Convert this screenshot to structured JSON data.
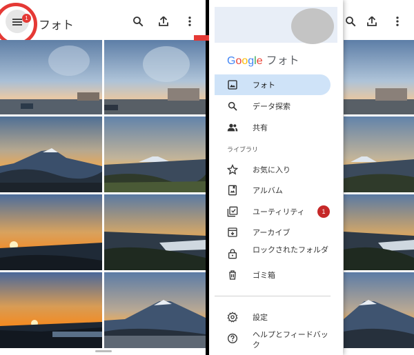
{
  "left": {
    "app_title": "フォト",
    "menu_badge": "1",
    "icons": [
      "menu-icon",
      "search-icon",
      "upload-icon",
      "more-vert-icon"
    ]
  },
  "right": {
    "brand_google": [
      "G",
      "o",
      "o",
      "g",
      "l",
      "e"
    ],
    "brand_colors": [
      "#4285F4",
      "#EA4335",
      "#FBBC05",
      "#4285F4",
      "#34A853",
      "#EA4335"
    ],
    "brand_sub": "フォト",
    "section_label": "ライブラリ",
    "nav": [
      {
        "label": "フォト",
        "icon": "photo-icon",
        "active": true
      },
      {
        "label": "データ探索",
        "icon": "search-icon"
      },
      {
        "label": "共有",
        "icon": "people-icon"
      },
      {
        "label": "お気に入り",
        "icon": "star-icon"
      },
      {
        "label": "アルバム",
        "icon": "album-icon"
      },
      {
        "label": "ユーティリティ",
        "icon": "utility-icon",
        "badge": "1"
      },
      {
        "label": "アーカイブ",
        "icon": "archive-icon"
      },
      {
        "label": "ロックされたフォルダ",
        "icon": "lock-icon"
      },
      {
        "label": "ゴミ箱",
        "icon": "trash-icon"
      },
      {
        "label": "設定",
        "icon": "settings-icon"
      },
      {
        "label": "ヘルプとフィードバック",
        "icon": "help-icon"
      }
    ]
  },
  "colors": {
    "highlight_red": "#e53935",
    "active_bg": "#cfe3f8",
    "badge_red": "#c62828"
  }
}
